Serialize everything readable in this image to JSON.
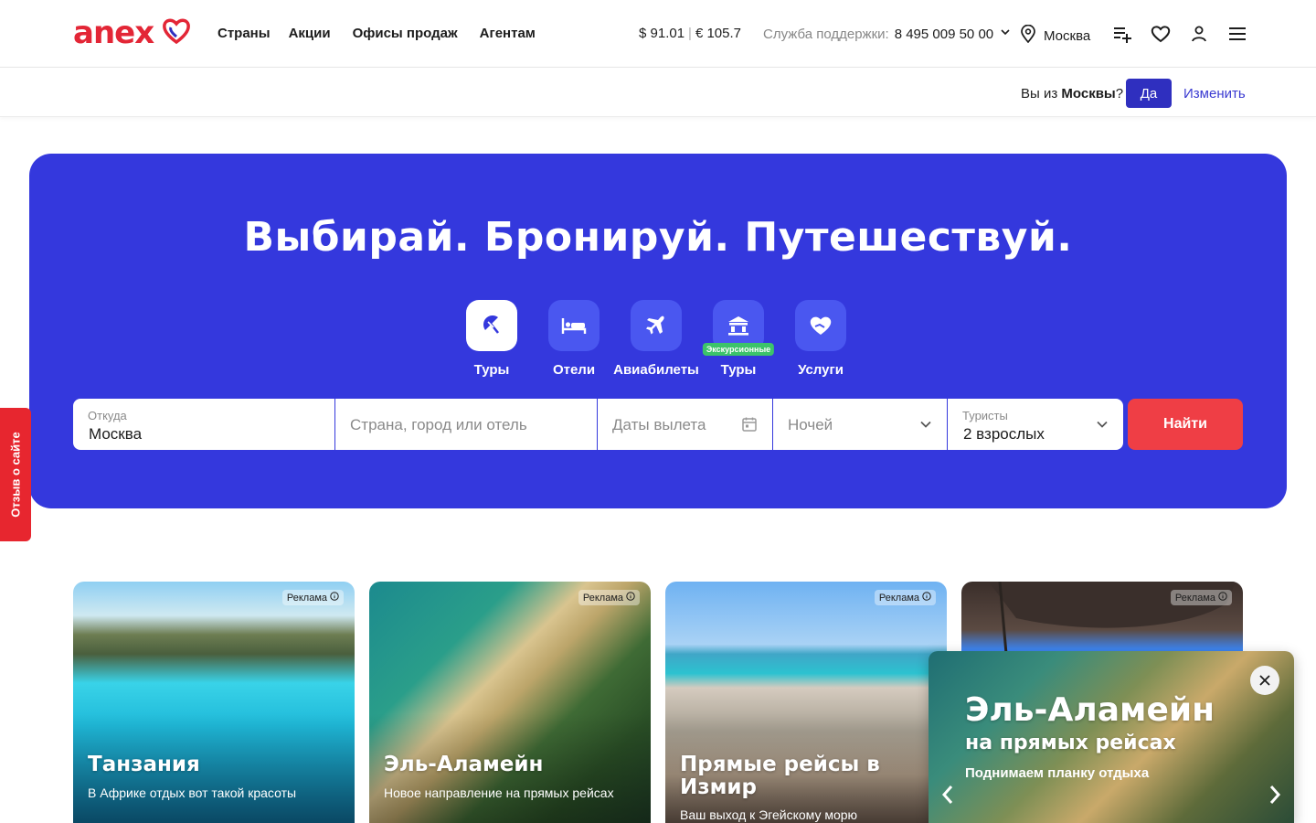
{
  "header": {
    "logo": "anex",
    "nav": [
      "Страны",
      "Акции",
      "Офисы продаж",
      "Агентам"
    ],
    "rate_usd": "$ 91.01",
    "rate_eur": "€ 105.7",
    "rate_sep": "|",
    "support_label": "Служба поддержки:",
    "support_phone": "8 495 009 50 00",
    "city": "Москва",
    "icons": [
      "playlist-add-icon",
      "heart-icon",
      "user-icon",
      "menu-icon"
    ]
  },
  "citybar": {
    "question_prefix": "Вы из ",
    "question_city": "Москвы",
    "question_suffix": "?",
    "yes_label": "Да",
    "change_label": "Изменить"
  },
  "hero": {
    "title": "Выбирай. Бронируй. Путешествуй.",
    "types": [
      {
        "label": "Туры",
        "icon": "beach-umbrella-icon",
        "active": true
      },
      {
        "label": "Отели",
        "icon": "bed-icon",
        "active": false
      },
      {
        "label": "Авиабилеты",
        "icon": "plane-icon",
        "active": false
      },
      {
        "label": "Туры",
        "icon": "temple-icon",
        "active": false,
        "badge": "Экскурсионные"
      },
      {
        "label": "Услуги",
        "icon": "heart-hand-icon",
        "active": false
      }
    ],
    "search": {
      "from_label": "Откуда",
      "from_value": "Москва",
      "dest_placeholder": "Страна, город или отель",
      "dates_placeholder": "Даты вылета",
      "nights_placeholder": "Ночей",
      "tourists_label": "Туристы",
      "tourists_value": "2 взрослых",
      "find_label": "Найти"
    }
  },
  "feedback": {
    "label": "Отзыв о сайте"
  },
  "cards": [
    {
      "ad": "Реклама",
      "title": "Танзания",
      "subtitle": "В Африке отдых вот такой красоты"
    },
    {
      "ad": "Реклама",
      "title": "Эль-Аламейн",
      "subtitle": "Новое направление на прямых рейсах"
    },
    {
      "ad": "Реклама",
      "title": "Прямые рейсы в Измир",
      "subtitle": "Ваш выход к Эгейскому морю"
    },
    {
      "ad": "Реклама",
      "title": "",
      "subtitle": ""
    }
  ],
  "popup": {
    "title": "Эль-Аламейн",
    "subtitle1": "на прямых рейсах",
    "subtitle2": "Поднимаем планку отдыха"
  },
  "colors": {
    "brand_red": "#e32636",
    "hero_blue": "#3438dd",
    "find_red": "#ef3e45",
    "yes_blue": "#2f2fbf",
    "badge_green": "#3cc36a"
  }
}
